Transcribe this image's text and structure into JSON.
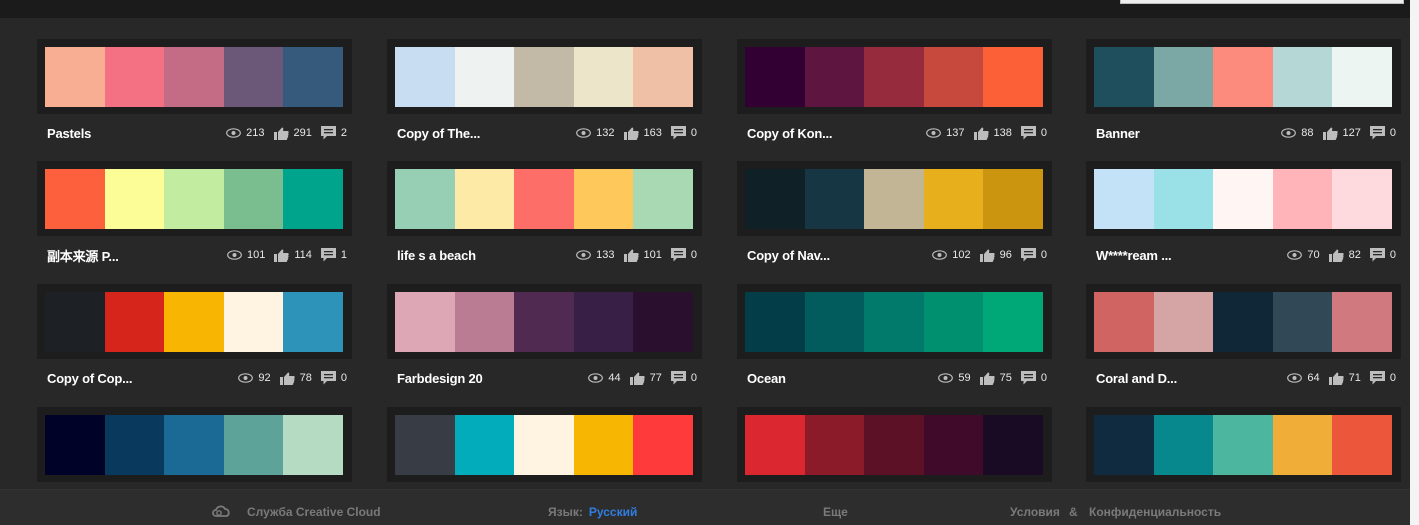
{
  "themes": [
    {
      "title": "Pastels",
      "views": "213",
      "likes": "291",
      "comments": "2",
      "colors": [
        "#f8ae93",
        "#f47183",
        "#c46b86",
        "#6b5879",
        "#355a7c"
      ]
    },
    {
      "title": "Copy of The...",
      "views": "132",
      "likes": "163",
      "comments": "0",
      "colors": [
        "#c9ddf2",
        "#eef3f2",
        "#c2baa6",
        "#ede5c9",
        "#efbfa6"
      ]
    },
    {
      "title": "Copy of Kon...",
      "views": "137",
      "likes": "138",
      "comments": "0",
      "colors": [
        "#330033",
        "#5e1540",
        "#962b3d",
        "#c7483c",
        "#fb6036"
      ]
    },
    {
      "title": "Banner",
      "views": "88",
      "likes": "127",
      "comments": "0",
      "colors": [
        "#1f4f5d",
        "#7ba7a5",
        "#fc8a7d",
        "#b5d7d6",
        "#ecf5f2"
      ]
    },
    {
      "title": "副本来源 P...",
      "views": "101",
      "likes": "114",
      "comments": "1",
      "colors": [
        "#fd603c",
        "#fdfd97",
        "#c2ec9f",
        "#7abd8e",
        "#00a38b"
      ]
    },
    {
      "title": "life s a beach",
      "views": "133",
      "likes": "101",
      "comments": "0",
      "colors": [
        "#96cfb3",
        "#feeaa7",
        "#fe6e68",
        "#fec95a",
        "#a8d9b2"
      ]
    },
    {
      "title": "Copy of Nav...",
      "views": "102",
      "likes": "96",
      "comments": "0",
      "colors": [
        "#0f2127",
        "#173644",
        "#c2b595",
        "#e7af1b",
        "#cb9510"
      ]
    },
    {
      "title": "W****ream ...",
      "views": "70",
      "likes": "82",
      "comments": "0",
      "colors": [
        "#c4e2f7",
        "#99e0e7",
        "#fff6f4",
        "#feb4b9",
        "#fed9dd"
      ]
    },
    {
      "title": "Copy of Cop...",
      "views": "92",
      "likes": "78",
      "comments": "0",
      "colors": [
        "#1d2126",
        "#d6261c",
        "#f8b501",
        "#fff4e2",
        "#2e93b9"
      ]
    },
    {
      "title": "Farbdesign 20",
      "views": "44",
      "likes": "77",
      "comments": "0",
      "colors": [
        "#dda7b5",
        "#b97c93",
        "#502a51",
        "#371f45",
        "#2b0f2f"
      ]
    },
    {
      "title": "Ocean",
      "views": "59",
      "likes": "75",
      "comments": "0",
      "colors": [
        "#033d47",
        "#025c5e",
        "#017a6c",
        "#00906f",
        "#00a877"
      ]
    },
    {
      "title": "Coral and D...",
      "views": "64",
      "likes": "71",
      "comments": "0",
      "colors": [
        "#d06463",
        "#d5a5a5",
        "#0f2737",
        "#314857",
        "#d07a80"
      ]
    },
    {
      "title": "",
      "views": "",
      "likes": "",
      "comments": "",
      "colors": [
        "#010227",
        "#093a5e",
        "#1b6a95",
        "#5da39a",
        "#b5dbc3"
      ]
    },
    {
      "title": "",
      "views": "",
      "likes": "",
      "comments": "",
      "colors": [
        "#373c45",
        "#03acba",
        "#fff3e1",
        "#f6b601",
        "#fe3a3b"
      ]
    },
    {
      "title": "",
      "views": "",
      "likes": "",
      "comments": "",
      "colors": [
        "#db2830",
        "#8c1b2a",
        "#5c1127",
        "#400b2a",
        "#180b23"
      ]
    },
    {
      "title": "",
      "views": "",
      "likes": "",
      "comments": "",
      "colors": [
        "#102b40",
        "#06888c",
        "#4cb79e",
        "#f0ae38",
        "#ec573c"
      ]
    }
  ],
  "footer": {
    "cc_label": "Служба Creative Cloud",
    "language_label": "Язык:",
    "language_value": "Русский",
    "more_label": "Еще",
    "terms_label": "Условия",
    "amp": "&",
    "privacy_label": "Конфиденциальность"
  }
}
